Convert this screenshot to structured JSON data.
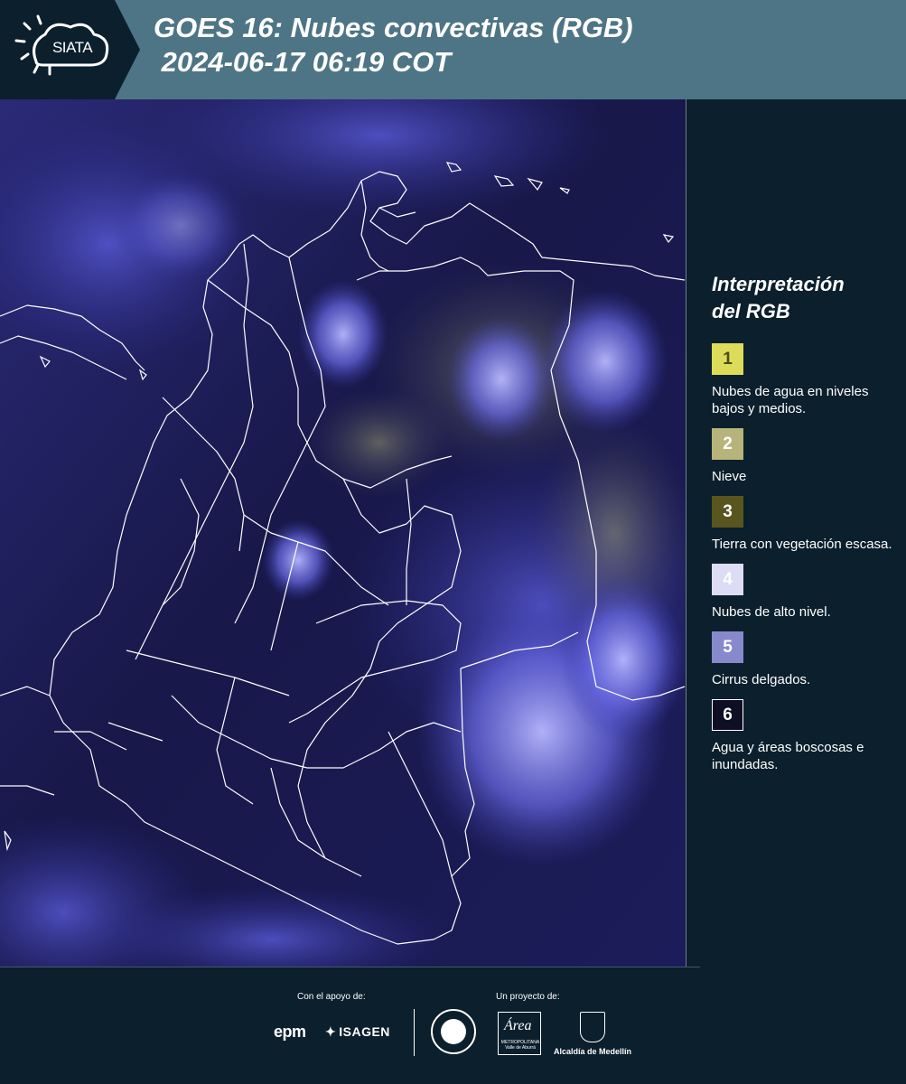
{
  "header": {
    "logo_text": "SIATA",
    "title_line1": "GOES 16: Nubes convectivas (RGB)",
    "title_line2": " 2024-06-17 06:19 COT"
  },
  "map": {
    "description_icon": "satellite-rgb-image-colombia",
    "colors": {
      "background": "#1a1a4e",
      "cloud": "#6a6ae6",
      "border": "#ffffff"
    }
  },
  "legend": {
    "title": "Interpretación\ndel RGB",
    "items": [
      {
        "number": "1",
        "label": "Nubes de agua en niveles bajos y medios.",
        "color": "#dcdc5a",
        "text_color": "#4a4a1a"
      },
      {
        "number": "2",
        "label": "Nieve",
        "color": "#b6b47a",
        "text_color": "#ffffff"
      },
      {
        "number": "3",
        "label": "Tierra con vegetación escasa.",
        "color": "#58561e",
        "text_color": "#ffffff"
      },
      {
        "number": "4",
        "label": "Nubes de alto nivel.",
        "color": "#dcdcf6",
        "text_color": "#ffffff"
      },
      {
        "number": "5",
        "label": "Cirrus delgados.",
        "color": "#8888cc",
        "text_color": "#ffffff"
      },
      {
        "number": "6",
        "label": "Agua y áreas boscosas e inundadas.",
        "color": "#0f0f24",
        "text_color": "#ffffff"
      }
    ]
  },
  "footer": {
    "support_label": "Con el apoyo de:",
    "project_label": "Un proyecto de:",
    "epm": "epm",
    "isagen": "ISAGEN",
    "area_script": "Área",
    "area_sub": "METROPOLITANA Valle de Aburrá",
    "alcaldia": "Alcaldía de Medellín"
  }
}
